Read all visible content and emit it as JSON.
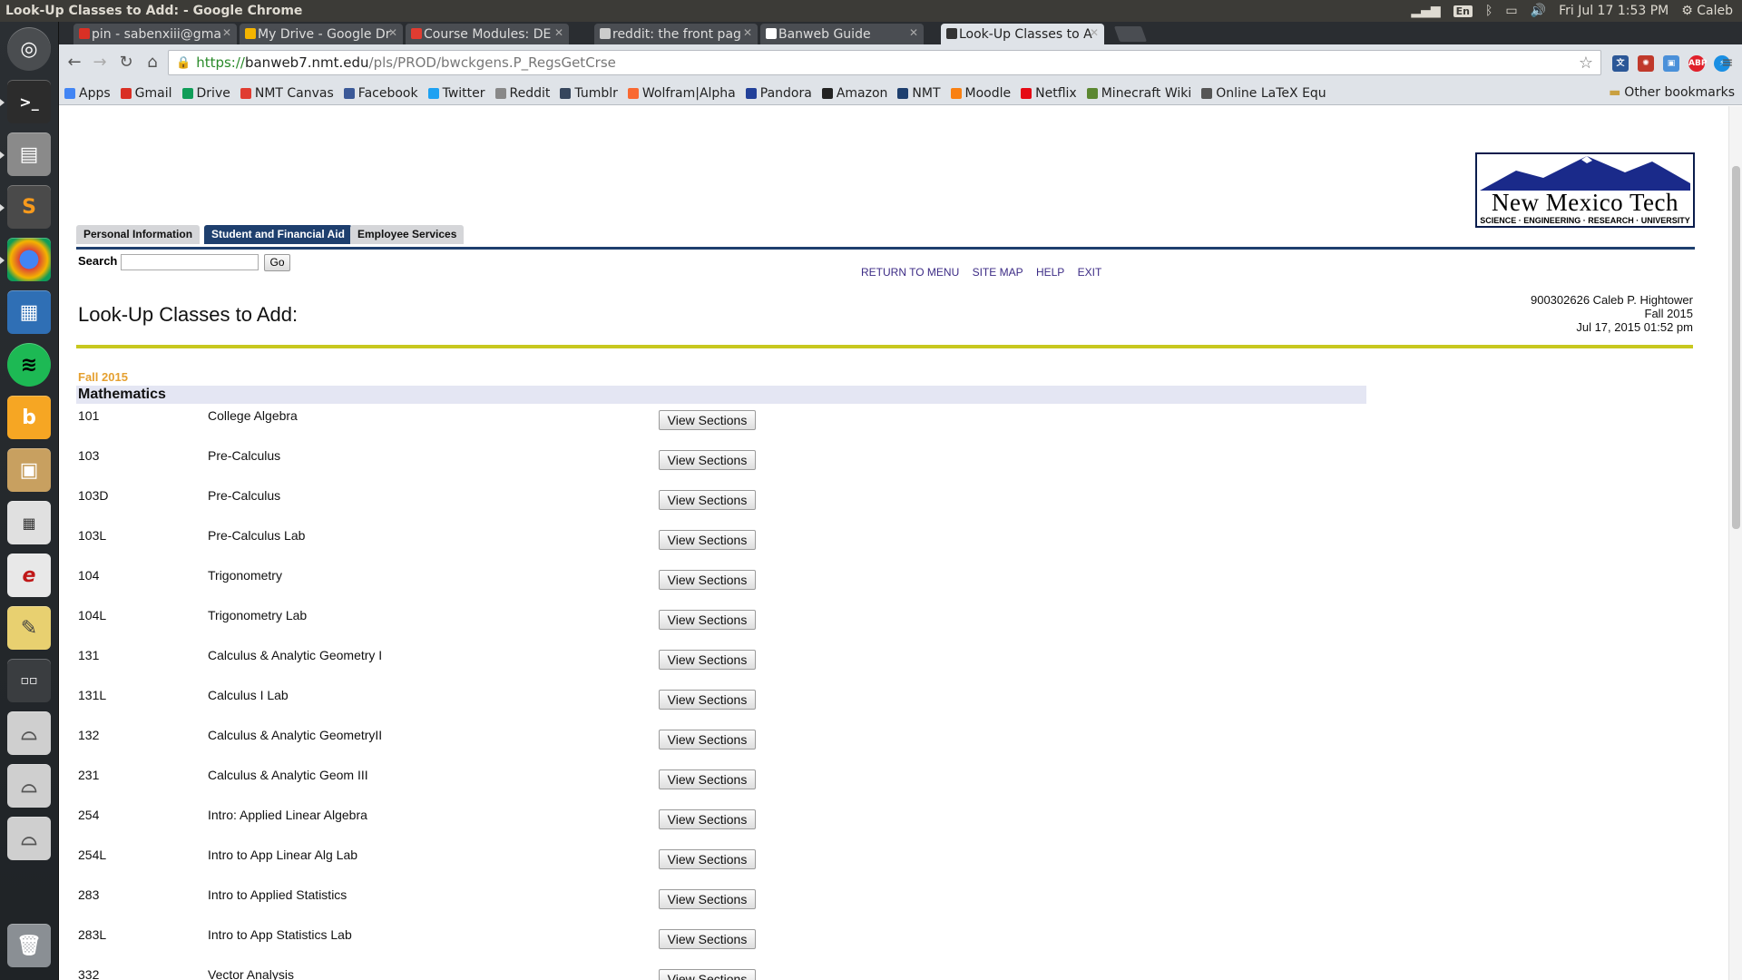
{
  "window_title": "Look-Up Classes to Add: - Google Chrome",
  "system": {
    "lang": "En",
    "clock": "Fri Jul 17  1:53 PM",
    "user": "Caleb",
    "user_tooltip": "Caleb"
  },
  "tabs": [
    {
      "label": "pin - sabenxiii@gma",
      "favicon_color": "#d93025"
    },
    {
      "label": "My Drive - Google Dr",
      "favicon_color": "#f4b400"
    },
    {
      "label": "Course Modules: DE",
      "favicon_color": "#e03c31"
    },
    {
      "label": "reddit: the front pag",
      "favicon_color": "#cccccc"
    },
    {
      "label": "Banweb Guide",
      "favicon_color": "#ffffff"
    },
    {
      "label": "Look-Up Classes to A",
      "favicon_color": "#333333"
    }
  ],
  "omnibox": {
    "secure": "https://",
    "host": "banweb7.nmt.edu",
    "path": "/pls/PROD/bwckgens.P_RegsGetCrse"
  },
  "bookmarks": [
    {
      "label": "Apps",
      "color": "#4285f4"
    },
    {
      "label": "Gmail",
      "color": "#d93025"
    },
    {
      "label": "Drive",
      "color": "#0f9d58"
    },
    {
      "label": "NMT Canvas",
      "color": "#e03c31"
    },
    {
      "label": "Facebook",
      "color": "#3b5998"
    },
    {
      "label": "Twitter",
      "color": "#1da1f2"
    },
    {
      "label": "Reddit",
      "color": "#888888"
    },
    {
      "label": "Tumblr",
      "color": "#36465d"
    },
    {
      "label": "Wolfram|Alpha",
      "color": "#f96932"
    },
    {
      "label": "Pandora",
      "color": "#224099"
    },
    {
      "label": "Amazon",
      "color": "#222222"
    },
    {
      "label": "NMT",
      "color": "#1e3f6e"
    },
    {
      "label": "Moodle",
      "color": "#f98012"
    },
    {
      "label": "Netflix",
      "color": "#e50914"
    },
    {
      "label": "Minecraft Wiki",
      "color": "#5b8731"
    },
    {
      "label": "Online LaTeX Equ",
      "color": "#555555"
    }
  ],
  "other_bookmarks": "Other bookmarks",
  "logo": {
    "name": "New Mexico Tech",
    "tagline": "SCIENCE · ENGINEERING · RESEARCH · UNIVERSITY"
  },
  "nav_tabs": [
    "Personal Information",
    "Student and Financial Aid",
    "Employee Services"
  ],
  "search": {
    "label": "Search",
    "value": "",
    "go": "Go"
  },
  "links": [
    "RETURN TO MENU",
    "SITE MAP",
    "HELP",
    "EXIT"
  ],
  "page_title": "Look-Up Classes to Add:",
  "user_info": {
    "line1": "900302626 Caleb P. Hightower",
    "line2": "Fall 2015",
    "line3": "Jul 17, 2015 01:52 pm"
  },
  "term": "Fall 2015",
  "subject": "Mathematics",
  "view_label": "View Sections",
  "courses": [
    {
      "num": "101",
      "title": "College Algebra"
    },
    {
      "num": "103",
      "title": "Pre-Calculus"
    },
    {
      "num": "103D",
      "title": "Pre-Calculus"
    },
    {
      "num": "103L",
      "title": "Pre-Calculus Lab"
    },
    {
      "num": "104",
      "title": "Trigonometry"
    },
    {
      "num": "104L",
      "title": "Trigonometry Lab"
    },
    {
      "num": "131",
      "title": "Calculus & Analytic Geometry I"
    },
    {
      "num": "131L",
      "title": "Calculus I Lab"
    },
    {
      "num": "132",
      "title": "Calculus & Analytic GeometryII"
    },
    {
      "num": "231",
      "title": "Calculus & Analytic Geom III"
    },
    {
      "num": "254",
      "title": "Intro: Applied Linear Algebra"
    },
    {
      "num": "254L",
      "title": "Intro to App Linear Alg Lab"
    },
    {
      "num": "283",
      "title": "Intro to Applied Statistics"
    },
    {
      "num": "283L",
      "title": "Intro to App Statistics Lab"
    },
    {
      "num": "332",
      "title": "Vector Analysis"
    }
  ]
}
